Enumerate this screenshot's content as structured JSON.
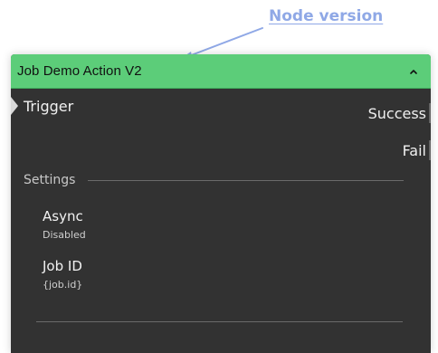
{
  "annotation": {
    "label": "Node version",
    "color": "#8fa8e6"
  },
  "node": {
    "title": "Job Demo Action V2",
    "header_color": "#5ccd79",
    "body_color": "#323232",
    "collapse_icon": "chevron-up-icon",
    "input_port": {
      "label": "Trigger"
    },
    "output_ports": [
      {
        "label": "Success"
      },
      {
        "label": "Fail"
      }
    ],
    "settings": {
      "section_label": "Settings",
      "fields": [
        {
          "name": "Async",
          "value": "Disabled"
        },
        {
          "name": "Job ID",
          "value": "{job.id}"
        }
      ]
    }
  }
}
